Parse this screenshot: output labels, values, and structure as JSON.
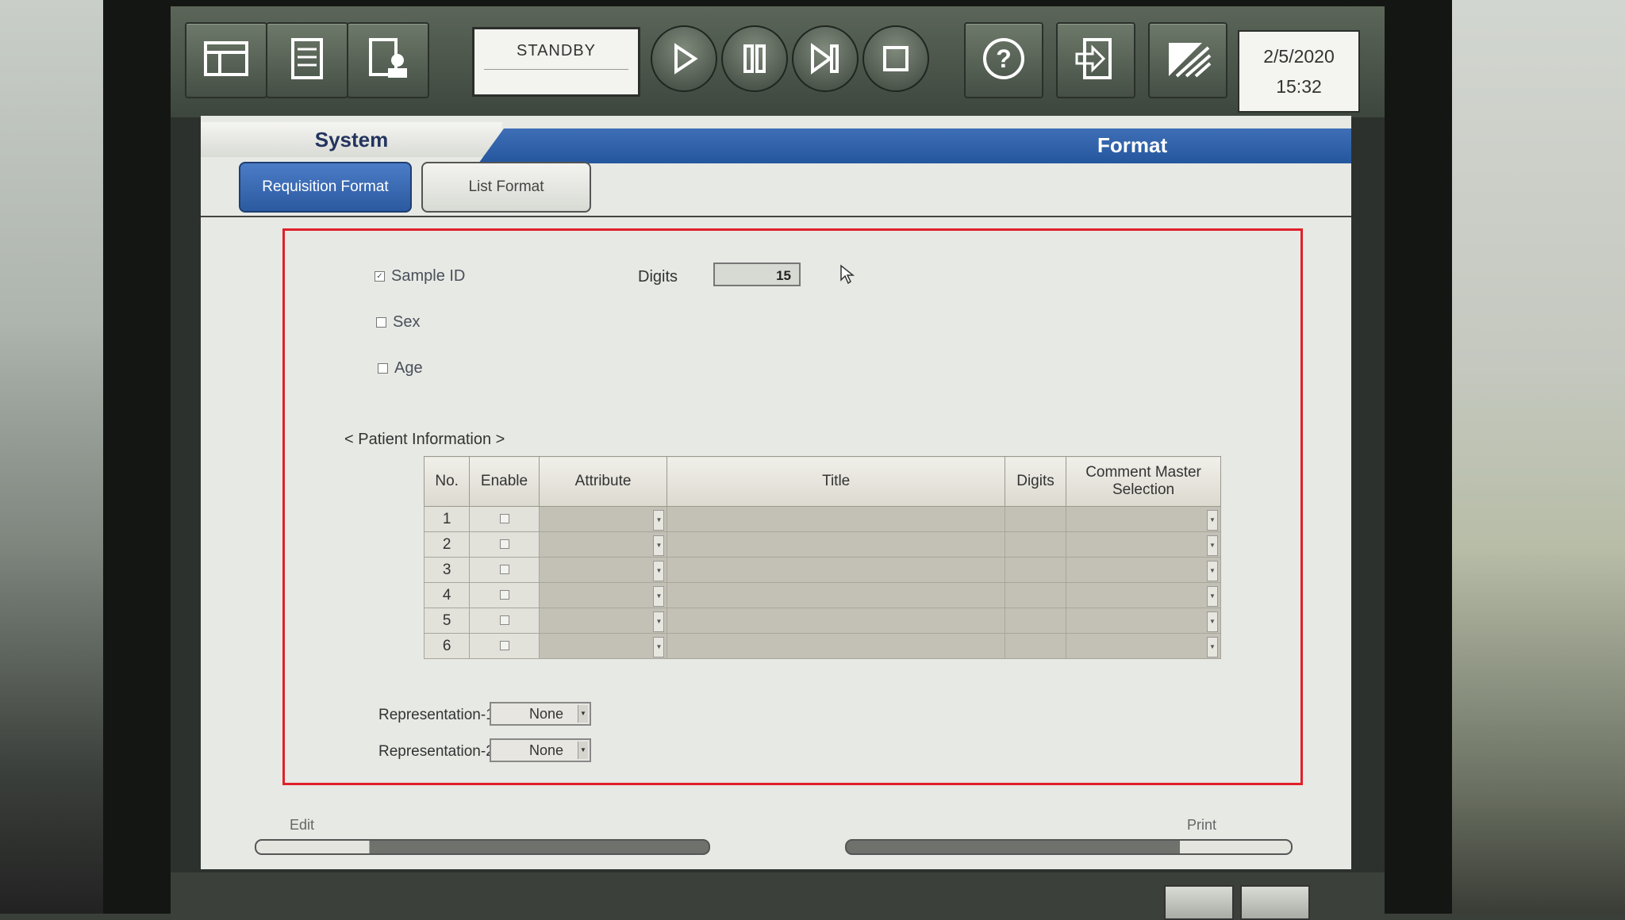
{
  "toolbar": {
    "status": "STANDBY",
    "date": "2/5/2020",
    "time": "15:32"
  },
  "header": {
    "section": "System",
    "title": "Format"
  },
  "tabs": [
    {
      "label": "Requisition Format",
      "active": true
    },
    {
      "label": "List Format",
      "active": false
    }
  ],
  "fields": {
    "sample_id": {
      "label": "Sample ID",
      "checked": true
    },
    "digits_label": "Digits",
    "digits_value": "15",
    "sex": {
      "label": "Sex",
      "checked": false
    },
    "age": {
      "label": "Age",
      "checked": false
    }
  },
  "patient_info": {
    "label": "< Patient Information >",
    "columns": [
      "No.",
      "Enable",
      "Attribute",
      "Title",
      "Digits",
      "Comment Master Selection"
    ],
    "rows": [
      {
        "no": "1"
      },
      {
        "no": "2"
      },
      {
        "no": "3"
      },
      {
        "no": "4"
      },
      {
        "no": "5"
      },
      {
        "no": "6"
      }
    ]
  },
  "representation": [
    {
      "label": "Representation-1",
      "value": "None"
    },
    {
      "label": "Representation-2",
      "value": "None"
    }
  ],
  "footer": {
    "edit_label": "Edit",
    "print_label": "Print"
  },
  "colors": {
    "accent_blue": "#2c5aa0",
    "highlight_border": "#e0202a"
  }
}
